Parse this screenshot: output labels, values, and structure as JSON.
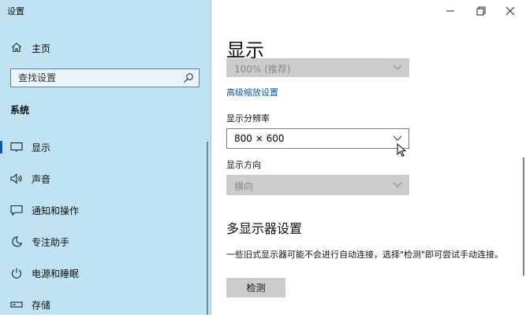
{
  "window": {
    "title": "设置"
  },
  "sidebar": {
    "home_label": "主页",
    "search_placeholder": "查找设置",
    "section_label": "系统",
    "items": [
      {
        "label": "显示",
        "icon": "monitor-icon",
        "selected": true
      },
      {
        "label": "声音",
        "icon": "speaker-icon",
        "selected": false
      },
      {
        "label": "通知和操作",
        "icon": "notification-icon",
        "selected": false
      },
      {
        "label": "专注助手",
        "icon": "moon-icon",
        "selected": false
      },
      {
        "label": "电源和睡眠",
        "icon": "power-icon",
        "selected": false
      },
      {
        "label": "存储",
        "icon": "storage-icon",
        "selected": false
      }
    ]
  },
  "main": {
    "title": "显示",
    "scale_value": "100% (推荐)",
    "advanced_scaling_link": "高级缩放设置",
    "resolution_label": "显示分辨率",
    "resolution_value": "800 × 600",
    "orientation_label": "显示方向",
    "orientation_value": "横向",
    "multi_display_title": "多显示器设置",
    "multi_display_desc": "一些旧式显示器可能不会进行自动连接，选择\"检测\"即可尝试手动连接。",
    "detect_button": "检测"
  },
  "colors": {
    "sidebar_bg": "#bfe3f2",
    "accent": "#0a58a8",
    "disabled_control": "#cccccc"
  }
}
